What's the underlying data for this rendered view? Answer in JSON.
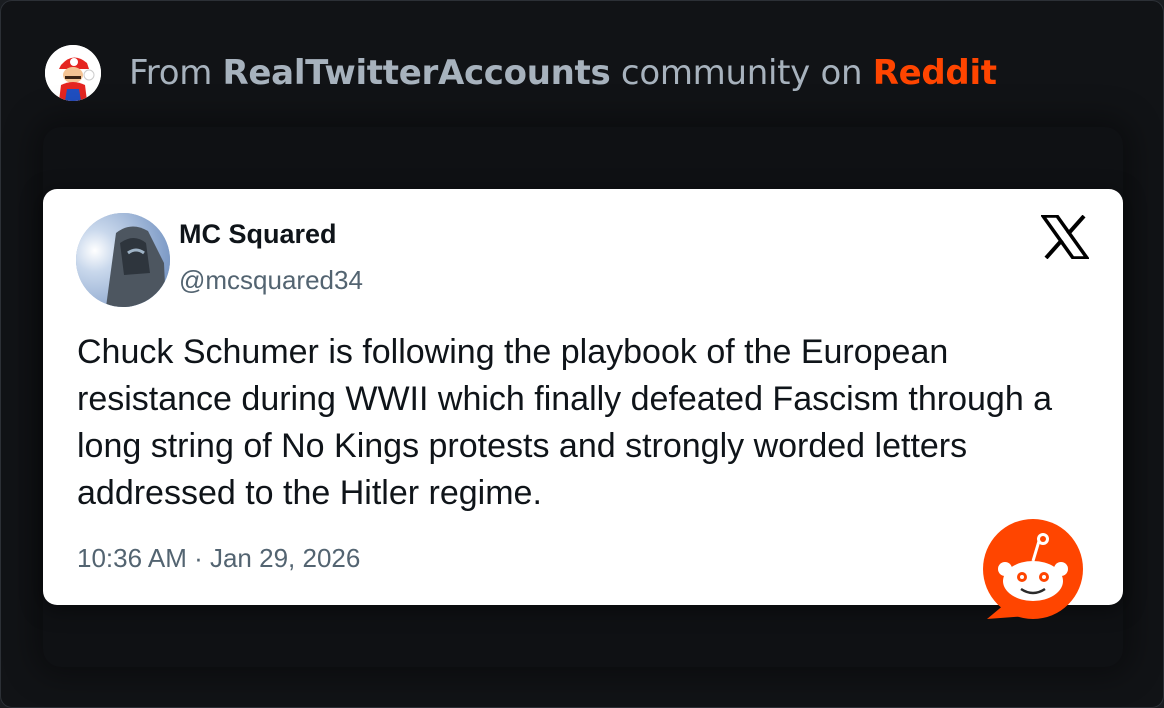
{
  "header": {
    "prefix": "From ",
    "community": "RealTwitterAccounts",
    "middle": " community on ",
    "platform": "Reddit",
    "platform_color": "#ff4500",
    "avatar_icon": "mario-avatar-icon"
  },
  "tweet": {
    "display_name": "MC Squared",
    "handle": "@mcsquared34",
    "text": "Chuck Schumer is following the playbook of the European resistance during WWII which finally defeated Fascism through a long string of No Kings protests and strongly worded letters addressed to the Hitler regime.",
    "time": "10:36 AM",
    "separator": " · ",
    "date": "Jan 29, 2026",
    "source_icon": "x-logo-icon"
  },
  "badge": {
    "icon": "reddit-snoo-icon",
    "color": "#ff4500"
  }
}
